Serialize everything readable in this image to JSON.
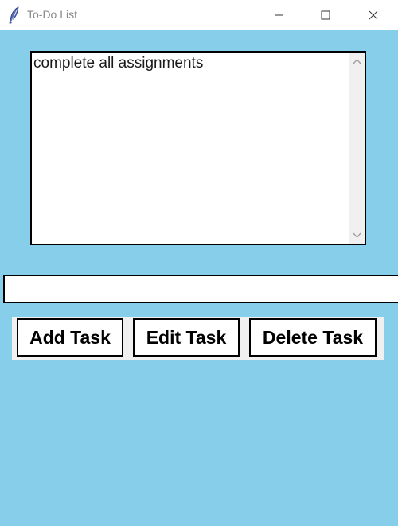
{
  "window": {
    "title": "To-Do List",
    "app_icon": "feather-icon"
  },
  "colors": {
    "background": "#87CEEB",
    "listbox_bg": "#ffffff",
    "button_frame_bg": "#f0f0f0",
    "border": "#000000"
  },
  "tasks": [
    "complete all assignments"
  ],
  "entry": {
    "value": ""
  },
  "buttons": {
    "add_label": "Add Task",
    "edit_label": "Edit Task",
    "delete_label": "Delete Task"
  }
}
